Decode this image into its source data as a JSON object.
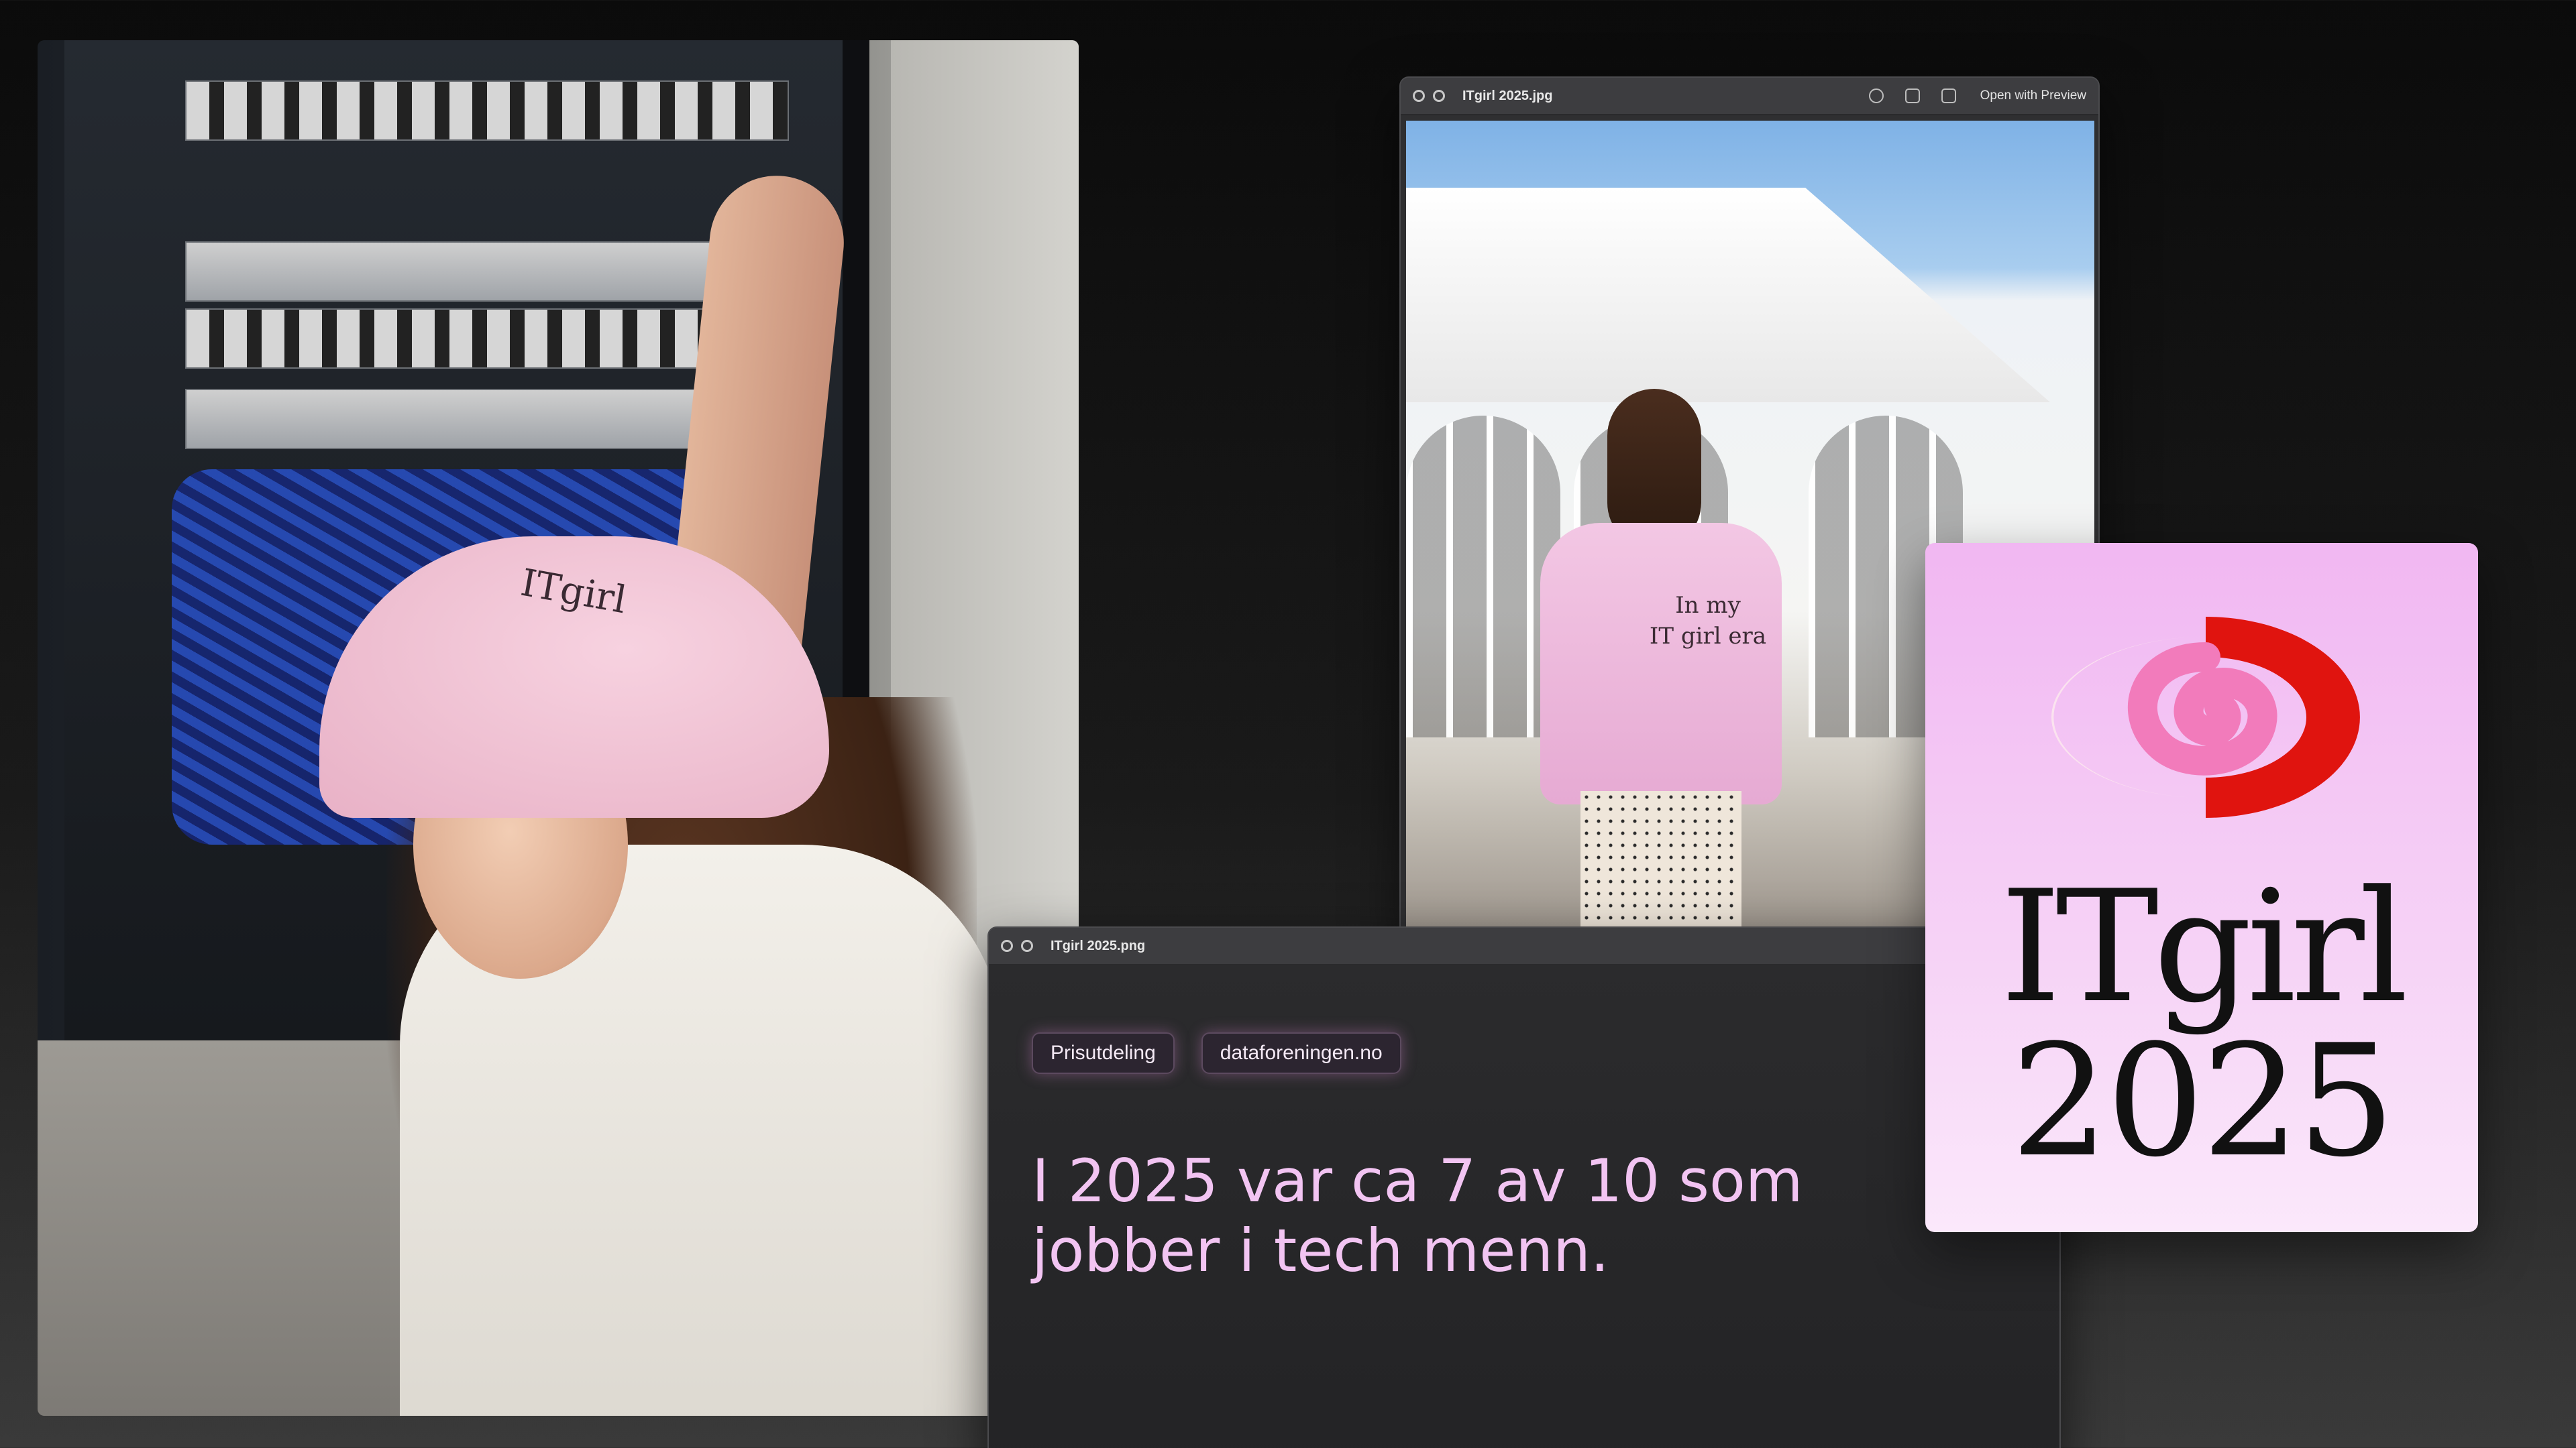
{
  "left_photo": {
    "cap_text": "ITgirl"
  },
  "window_jpg": {
    "title": "ITgirl 2025.jpg",
    "action_label": "Open with Preview",
    "shirt_line1": "In my",
    "shirt_line2": "IT girl era"
  },
  "window_png": {
    "title": "ITgirl 2025.png",
    "chips": [
      "Prisutdeling",
      "dataforeningen.no"
    ],
    "headline_line1": "I 2025 var ca 7 av 10 som",
    "headline_line2": "jobber i tech menn."
  },
  "logo_card": {
    "word": "ITgirl",
    "year": "2025"
  },
  "colors": {
    "accent_pink": "#f2c4f2",
    "logo_red": "#e0140f",
    "logo_pink": "#f27bbb"
  }
}
